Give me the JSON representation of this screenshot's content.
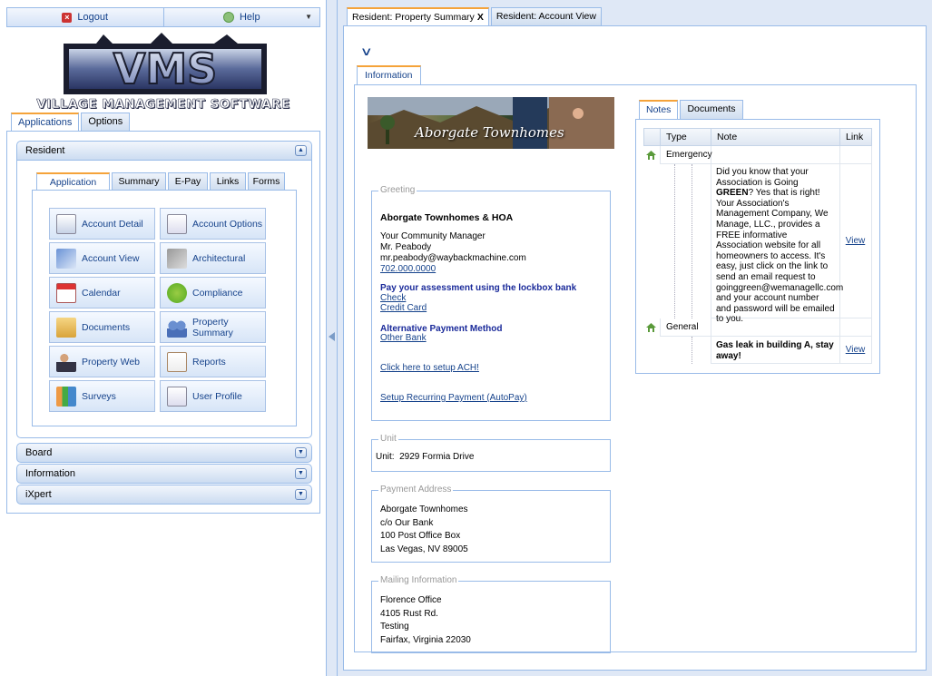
{
  "topbar": {
    "logout": "Logout",
    "help": "Help"
  },
  "logo": {
    "letters": "VMS",
    "subtitle": "VILLAGE MANAGEMENT SOFTWARE"
  },
  "left_tabs": [
    "Applications",
    "Options"
  ],
  "accordion": {
    "resident": "Resident",
    "board": "Board",
    "information": "Information",
    "ixpert": "iXpert"
  },
  "app_tabs": [
    "Application",
    "Summary",
    "E-Pay",
    "Links",
    "Forms"
  ],
  "tiles": [
    "Account Detail",
    "Account Options",
    "Account View",
    "Architectural",
    "Calendar",
    "Compliance",
    "Documents",
    "Property Summary",
    "Property Web",
    "Reports",
    "Surveys",
    "User Profile"
  ],
  "top_tabs": {
    "summary": "Resident: Property Summary",
    "close": "X",
    "account": "Resident: Account View"
  },
  "info_tab": "Information",
  "banner_text": "Aborgate Townhomes",
  "greeting": {
    "legend": "Greeting",
    "title": "Aborgate Townhomes & HOA",
    "line1": "Your Community Manager",
    "line2": "Mr. Peabody",
    "email": "mr.peabody@waybackmachine.com",
    "phone": "702.000.0000",
    "pay_heading": "Pay your assessment using the lockbox bank",
    "check": "Check",
    "credit": "Credit Card",
    "alt_heading": "Alternative Payment Method",
    "other_bank": "Other Bank",
    "ach": "Click here to setup ACH!",
    "autopay": "Setup Recurring Payment (AutoPay)"
  },
  "unit": {
    "legend": "Unit",
    "label": "Unit:",
    "value": "2929 Formia Drive"
  },
  "payment_address": {
    "legend": "Payment Address",
    "lines": [
      "Aborgate Townhomes",
      "c/o Our Bank",
      "100 Post Office Box",
      "Las Vegas, NV 89005"
    ]
  },
  "mailing": {
    "legend": "Mailing Information",
    "lines": [
      "Florence Office",
      "4105 Rust Rd.",
      "Testing",
      "Fairfax, Virginia 22030"
    ]
  },
  "notes_tabs": [
    "Notes",
    "Documents"
  ],
  "grid": {
    "headers": [
      "Type",
      "Note",
      "Link"
    ],
    "groups": [
      {
        "type": "Emergency",
        "note_pre": "Did you know that your Association is Going ",
        "note_bold": "GREEN",
        "note_post": "? Yes that is right! Your Association's Management Company, We Manage, LLC., provides a FREE informative Association website for all homeowners to access. It's easy, just click on the link to send an email request to goinggreen@wemanagellc.com and your account number and password will be emailed to you.",
        "link": "View"
      },
      {
        "type": "General",
        "note_bold": "Gas leak in building A, stay away!",
        "link": "View"
      }
    ]
  },
  "colors": {
    "accent": "#f5a33a",
    "border": "#99bbe8",
    "link": "#15428b",
    "background": "#dfe8f6"
  }
}
